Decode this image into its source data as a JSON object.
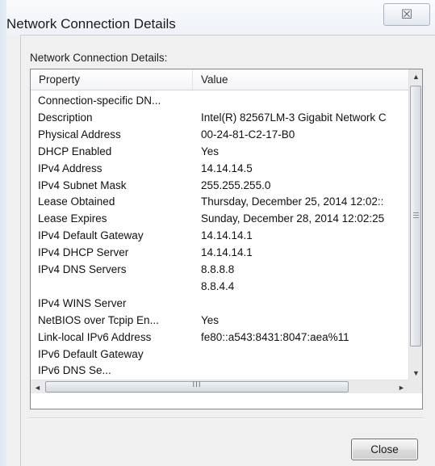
{
  "window": {
    "title": "Network Connection Details",
    "close_glyph": "☒"
  },
  "details": {
    "label": "Network Connection Details:",
    "columns": {
      "property": "Property",
      "value": "Value"
    },
    "rows": [
      {
        "property": "Connection-specific DN...",
        "value": ""
      },
      {
        "property": "Description",
        "value": "Intel(R) 82567LM-3 Gigabit Network C"
      },
      {
        "property": "Physical Address",
        "value": "00-24-81-C2-17-B0"
      },
      {
        "property": "DHCP Enabled",
        "value": "Yes"
      },
      {
        "property": "IPv4 Address",
        "value": "14.14.14.5"
      },
      {
        "property": "IPv4 Subnet Mask",
        "value": "255.255.255.0"
      },
      {
        "property": "Lease Obtained",
        "value": "Thursday, December 25, 2014 12:02::"
      },
      {
        "property": "Lease Expires",
        "value": "Sunday, December 28, 2014 12:02:25"
      },
      {
        "property": "IPv4 Default Gateway",
        "value": "14.14.14.1"
      },
      {
        "property": "IPv4 DHCP Server",
        "value": "14.14.14.1"
      },
      {
        "property": "IPv4 DNS Servers",
        "value": "8.8.8.8"
      },
      {
        "property": "",
        "value": "8.8.4.4"
      },
      {
        "property": "IPv4 WINS Server",
        "value": ""
      },
      {
        "property": "NetBIOS over Tcpip En...",
        "value": "Yes"
      },
      {
        "property": "Link-local IPv6 Address",
        "value": "fe80::a543:8431:8047:aea%11"
      },
      {
        "property": "IPv6 Default Gateway",
        "value": ""
      },
      {
        "property": "IPv6 DNS Se...",
        "value": ""
      }
    ],
    "scrollbars": {
      "up": "▲",
      "down": "▼",
      "left": "◄",
      "right": "►",
      "h_grip": "III"
    }
  },
  "buttons": {
    "close": "Close"
  }
}
